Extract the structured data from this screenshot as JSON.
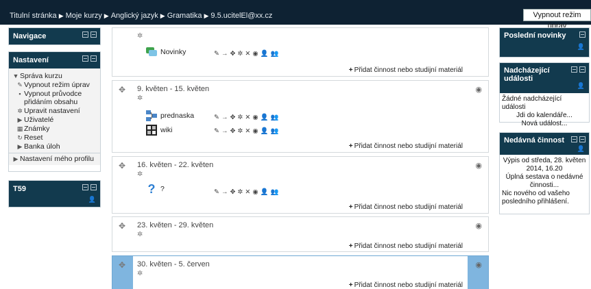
{
  "breadcrumb": [
    "Titulní stránka",
    "Moje kurzy",
    "Anglický jazyk",
    "Gramatika",
    "9.5.ucitelEl@xx.cz"
  ],
  "breadcrumb_sep": "▶",
  "top": {
    "edit_button": "Vypnout režim úprav"
  },
  "blocks": {
    "navigation": {
      "title": "Navigace"
    },
    "settings": {
      "title": "Nastavení",
      "root": "Správa kurzu",
      "items": [
        "Vypnout režim úprav",
        "Vypnout průvodce přidáním obsahu",
        "Upravit nastavení",
        "Uživatelé",
        "Známky",
        "Reset",
        "Banka úloh"
      ],
      "profile": "Nastavení mého profilu"
    },
    "t59": {
      "title": "T59"
    }
  },
  "add_label": "Přidat činnost nebo studijní materiál",
  "sections": [
    {
      "title": "",
      "activities": [
        {
          "name": "Novinky",
          "icon": "forum-icon"
        }
      ]
    },
    {
      "title": "9. květen - 15. květen",
      "activities": [
        {
          "name": "prednaska",
          "icon": "lesson-icon"
        },
        {
          "name": "wiki",
          "icon": "wiki-icon"
        }
      ]
    },
    {
      "title": "16. květen - 22. květen",
      "activities": [
        {
          "name": "?",
          "icon": "question-icon"
        }
      ]
    },
    {
      "title": "23. květen - 29. květen",
      "activities": []
    },
    {
      "title": "30. květen - 5. červen",
      "activities": [],
      "highlighted": true
    }
  ],
  "right": {
    "news": {
      "title": "Poslední novinky"
    },
    "events": {
      "title": "Nadcházející události",
      "empty": "Žádné nadcházející události",
      "calendar": "Jdi do kalendáře...",
      "new_event": "Nová událost..."
    },
    "recent": {
      "title": "Nedávná činnost",
      "since": "Výpis od středa, 28. květen 2014, 16.20",
      "full_report": "Úplná sestava o nedávné činnosti...",
      "nothing": "Nic nového od vašeho posledního přihlášení."
    }
  },
  "colors": {
    "topbar": "#0e2233",
    "block_header": "#123a4e",
    "highlight": "#7fb5df"
  }
}
